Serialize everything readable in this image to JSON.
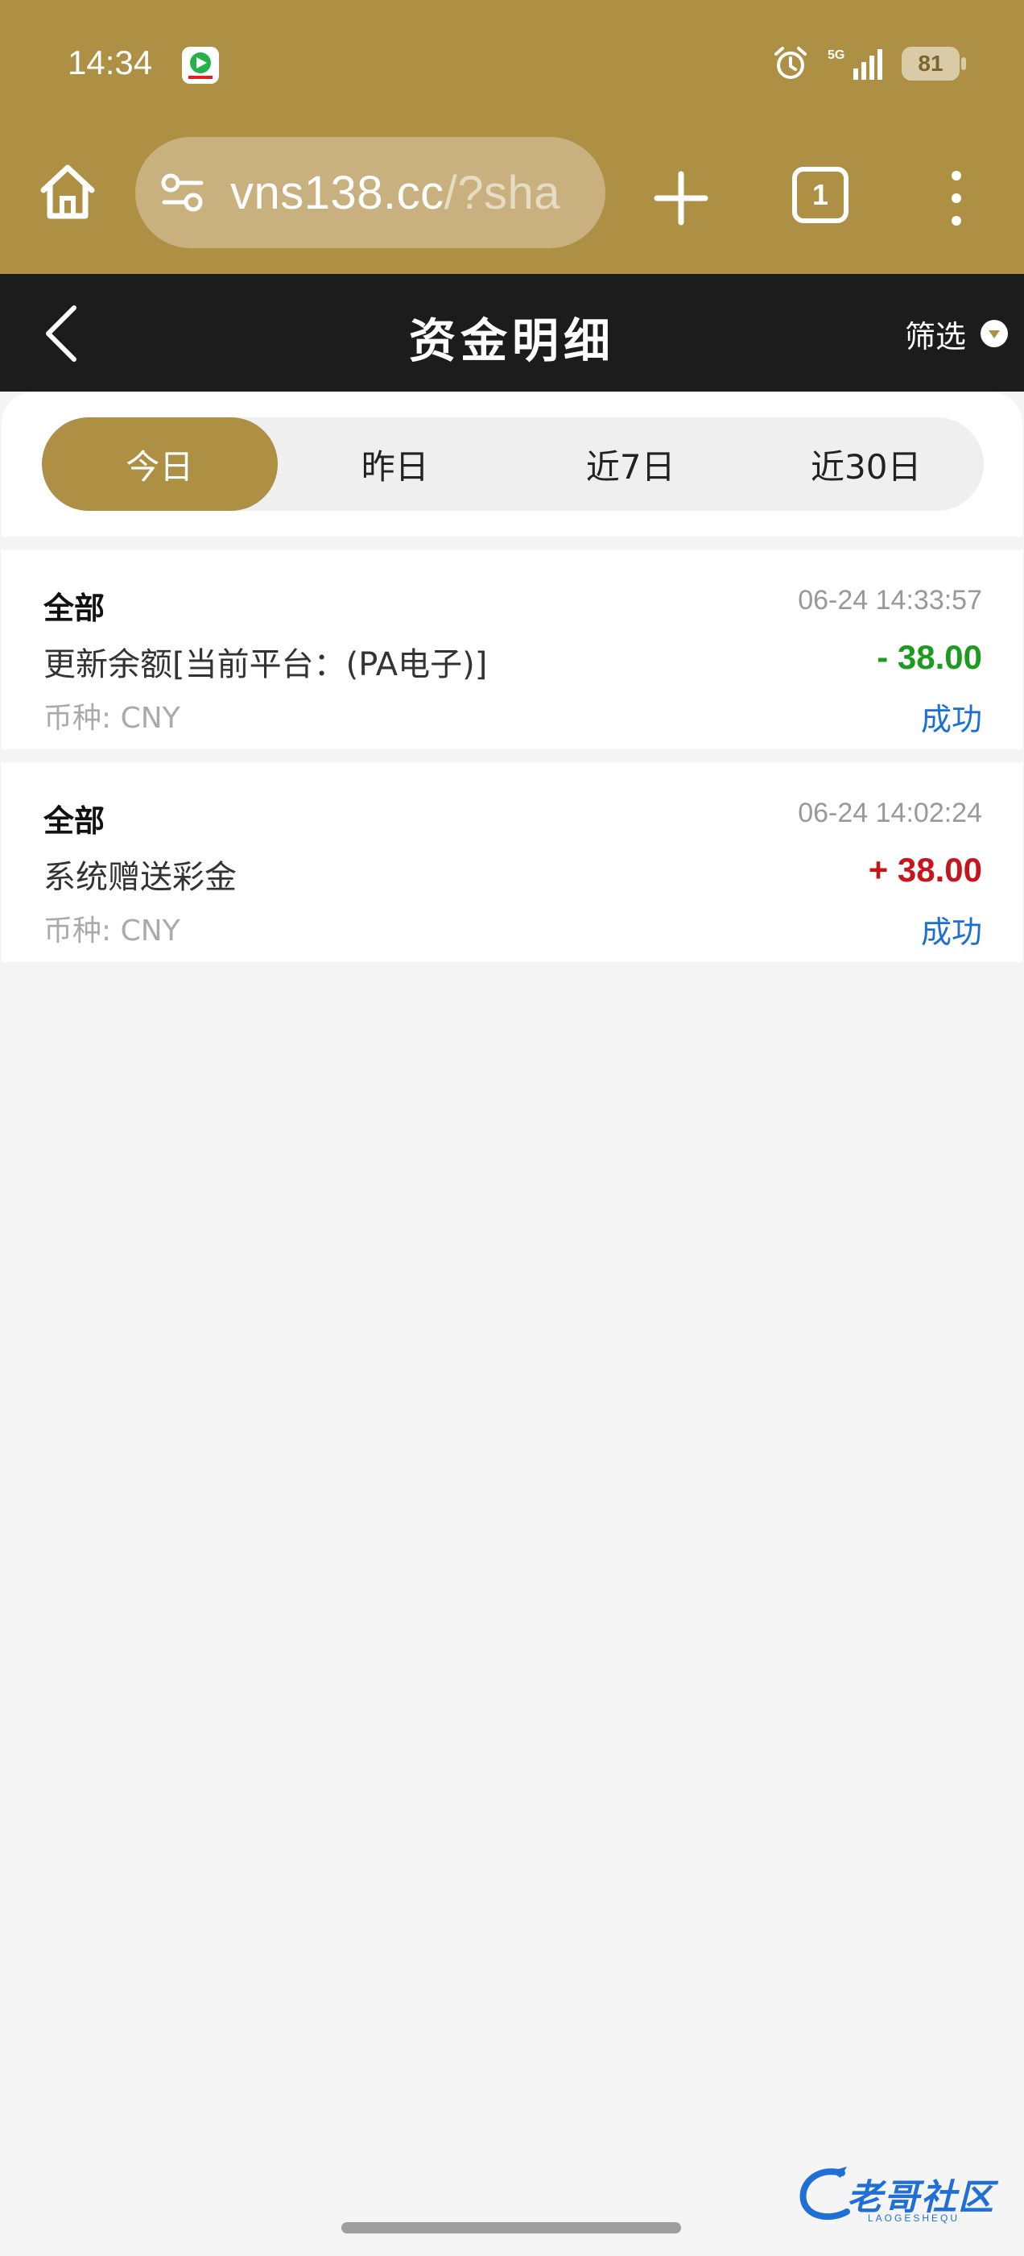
{
  "status_bar": {
    "time": "14:34",
    "network": "5G",
    "battery": "81"
  },
  "browser": {
    "url_main": "vns138.cc",
    "url_rest": "/?sha",
    "tab_count": "1",
    "icons": [
      "home-icon",
      "site-settings-icon",
      "plus-icon",
      "tabs-icon",
      "more-vertical-icon"
    ]
  },
  "header": {
    "title": "资金明细",
    "filter_label": "筛选"
  },
  "tabs": [
    {
      "label": "今日",
      "active": true
    },
    {
      "label": "昨日",
      "active": false
    },
    {
      "label": "近7日",
      "active": false
    },
    {
      "label": "近30日",
      "active": false
    }
  ],
  "records": [
    {
      "category": "全部",
      "time": "06-24 14:33:57",
      "description": "更新余额[当前平台：(PA电子)]",
      "amount": "- 38.00",
      "amount_color": "#1e9a1e",
      "currency": "币种: CNY",
      "status": "成功"
    },
    {
      "category": "全部",
      "time": "06-24 14:02:24",
      "description": "系统赠送彩金",
      "amount": "+ 38.00",
      "amount_color": "#c4161c",
      "currency": "币种: CNY",
      "status": "成功"
    }
  ],
  "watermark": {
    "text": "老哥社区",
    "sub": "LAOGESHEQU"
  },
  "colors": {
    "accent": "#ad9044",
    "header_bg": "#1c1c1c",
    "status_blue": "#1c6fd1"
  }
}
